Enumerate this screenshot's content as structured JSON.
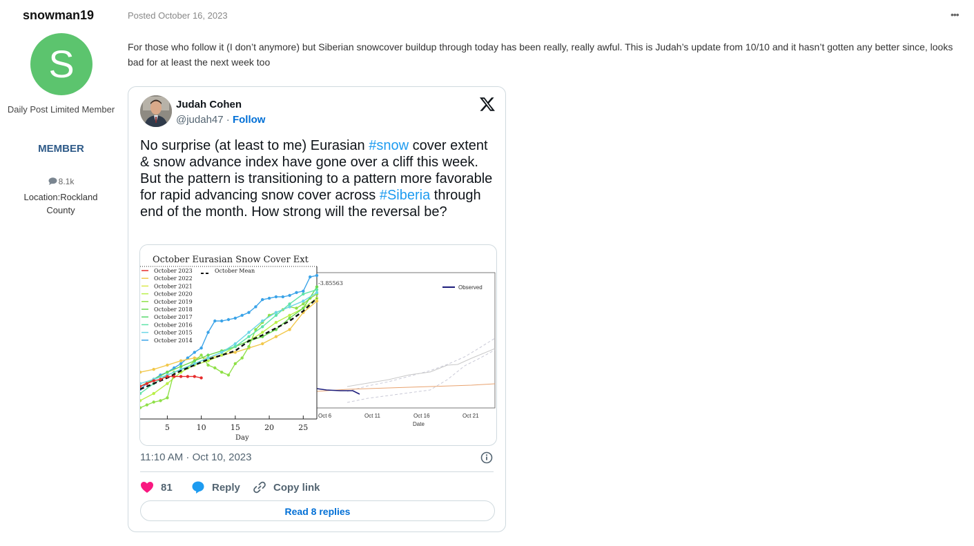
{
  "post": {
    "author": "snowman19",
    "avatar_letter": "S",
    "avatar_color": "#5cc46e",
    "rank": "Daily Post Limited Member",
    "group": "MEMBER",
    "post_count": "8.1k",
    "location": "Location:Rockland County",
    "posted": "Posted October 16, 2023",
    "more_menu": "•••",
    "body": "For those who follow it (I don’t anymore) but Siberian snowcover buildup through today has been really, really awful. This is Judah’s update from 10/10 and it hasn’t gotten any better since, looks bad for at least the next week too"
  },
  "tweet": {
    "name": "Judah Cohen",
    "handle": "@judah47",
    "separator": " · ",
    "follow": "Follow",
    "text_parts": [
      "No surprise (at least to me) Eurasian ",
      "#snow",
      " cover extent & snow advance index have gone over a cliff this week. But the pattern is transitioning to a pattern more favorable for rapid advancing snow cover across ",
      "#Siberia",
      " through end of the month. How strong will the reversal be?"
    ],
    "timestamp": "11:10 AM · Oct 10, 2023",
    "likes": "81",
    "reply": "Reply",
    "copy_link": "Copy link",
    "read_replies": "Read 8 replies",
    "like_color": "#f91880",
    "reply_color": "#1d9bf0"
  },
  "chart_data": [
    {
      "type": "line",
      "title": "October Eurasian Snow Cover Ext",
      "xlabel": "Day",
      "xticks": [
        5,
        10,
        15,
        20,
        25
      ],
      "xlim": [
        1,
        27
      ],
      "ylim": [
        0,
        1
      ],
      "legend": [
        "October 2023",
        "October 2022",
        "October 2021",
        "October 2020",
        "October 2019",
        "October 2018",
        "October 2017",
        "October 2016",
        "October 2015",
        "October 2014"
      ],
      "legend_colors": [
        "#e62b2b",
        "#f2c84b",
        "#d9e84a",
        "#b9ef47",
        "#8fe048",
        "#6bd850",
        "#55d96b",
        "#5ee3a8",
        "#6ad6e6",
        "#3aa3e8"
      ],
      "mean_label": "October Mean",
      "series": [
        {
          "name": "October 2014",
          "color": "#3aa3e8",
          "x": [
            1,
            2,
            3,
            4,
            5,
            6,
            7,
            8,
            9,
            10,
            11,
            12,
            13,
            14,
            15,
            16,
            17,
            18,
            19,
            20,
            21,
            22,
            23,
            24,
            25,
            26,
            27
          ],
          "y": [
            0.18,
            0.22,
            0.25,
            0.28,
            0.3,
            0.33,
            0.36,
            0.4,
            0.44,
            0.47,
            0.58,
            0.66,
            0.66,
            0.67,
            0.68,
            0.7,
            0.72,
            0.76,
            0.81,
            0.82,
            0.83,
            0.83,
            0.84,
            0.86,
            0.87,
            0.97,
            0.98
          ]
        },
        {
          "name": "October 2022",
          "color": "#f2c84b",
          "x": [
            1,
            3,
            5,
            7,
            9,
            11,
            13,
            15,
            17,
            19,
            21,
            23,
            25,
            27
          ],
          "y": [
            0.3,
            0.32,
            0.35,
            0.38,
            0.4,
            0.4,
            0.42,
            0.44,
            0.47,
            0.5,
            0.55,
            0.6,
            0.72,
            0.8
          ]
        },
        {
          "name": "October 2020",
          "color": "#b9ef47",
          "x": [
            1,
            3,
            5,
            7,
            9,
            11,
            13,
            15,
            17,
            19,
            21,
            23,
            25,
            27
          ],
          "y": [
            0.1,
            0.15,
            0.22,
            0.3,
            0.35,
            0.38,
            0.42,
            0.48,
            0.52,
            0.58,
            0.65,
            0.7,
            0.75,
            0.82
          ]
        },
        {
          "name": "October 2019",
          "color": "#8fe048",
          "x": [
            1,
            2,
            3,
            4,
            5,
            6,
            7,
            8,
            9,
            10,
            11,
            12,
            13,
            14,
            15,
            16,
            17,
            18,
            19,
            20,
            21,
            22,
            23,
            24,
            25,
            26,
            27
          ],
          "y": [
            0.05,
            0.07,
            0.09,
            0.1,
            0.12,
            0.3,
            0.32,
            0.33,
            0.38,
            0.42,
            0.35,
            0.33,
            0.3,
            0.28,
            0.36,
            0.4,
            0.48,
            0.6,
            0.65,
            0.7,
            0.72,
            0.74,
            0.76,
            0.75,
            0.78,
            0.82,
            0.85
          ]
        },
        {
          "name": "October 2018",
          "color": "#6bd850",
          "x": [
            1,
            3,
            5,
            7,
            9,
            11,
            13,
            15,
            17,
            19,
            21,
            23,
            25,
            27
          ],
          "y": [
            0.2,
            0.25,
            0.3,
            0.34,
            0.38,
            0.42,
            0.45,
            0.48,
            0.52,
            0.55,
            0.6,
            0.68,
            0.75,
            0.9
          ]
        },
        {
          "name": "October 2016",
          "color": "#5ee3a8",
          "x": [
            1,
            3,
            5,
            7,
            9,
            11,
            13,
            15,
            17,
            19,
            21,
            23,
            25,
            27
          ],
          "y": [
            0.15,
            0.22,
            0.28,
            0.32,
            0.36,
            0.4,
            0.44,
            0.48,
            0.55,
            0.62,
            0.7,
            0.78,
            0.85,
            0.88
          ]
        },
        {
          "name": "October 2015",
          "color": "#6ad6e6",
          "x": [
            1,
            3,
            5,
            7,
            9,
            11,
            13,
            15,
            17,
            19,
            21,
            23,
            25,
            27
          ],
          "y": [
            0.22,
            0.25,
            0.28,
            0.32,
            0.36,
            0.4,
            0.44,
            0.5,
            0.58,
            0.66,
            0.72,
            0.76,
            0.8,
            0.86
          ]
        },
        {
          "name": "October Mean",
          "color": "#111111",
          "dashed": true,
          "x": [
            1,
            3,
            5,
            7,
            9,
            11,
            13,
            15,
            17,
            19,
            21,
            23,
            25,
            27
          ],
          "y": [
            0.18,
            0.22,
            0.26,
            0.31,
            0.35,
            0.39,
            0.42,
            0.45,
            0.52,
            0.56,
            0.61,
            0.66,
            0.73,
            0.82
          ]
        },
        {
          "name": "October 2023",
          "color": "#e62b2b",
          "x": [
            1,
            2,
            3,
            4,
            5,
            6,
            7,
            8,
            9,
            10
          ],
          "y": [
            0.2,
            0.22,
            0.24,
            0.25,
            0.27,
            0.27,
            0.27,
            0.27,
            0.27,
            0.26
          ]
        }
      ]
    },
    {
      "type": "line",
      "xlabel": "Date",
      "xticks": [
        "Oct 6",
        "Oct 11",
        "Oct 16",
        "Oct 21"
      ],
      "legend": [
        "Observed"
      ],
      "legend_colors": [
        "#1b1b7a"
      ],
      "annotation": "-3.85563"
    }
  ]
}
